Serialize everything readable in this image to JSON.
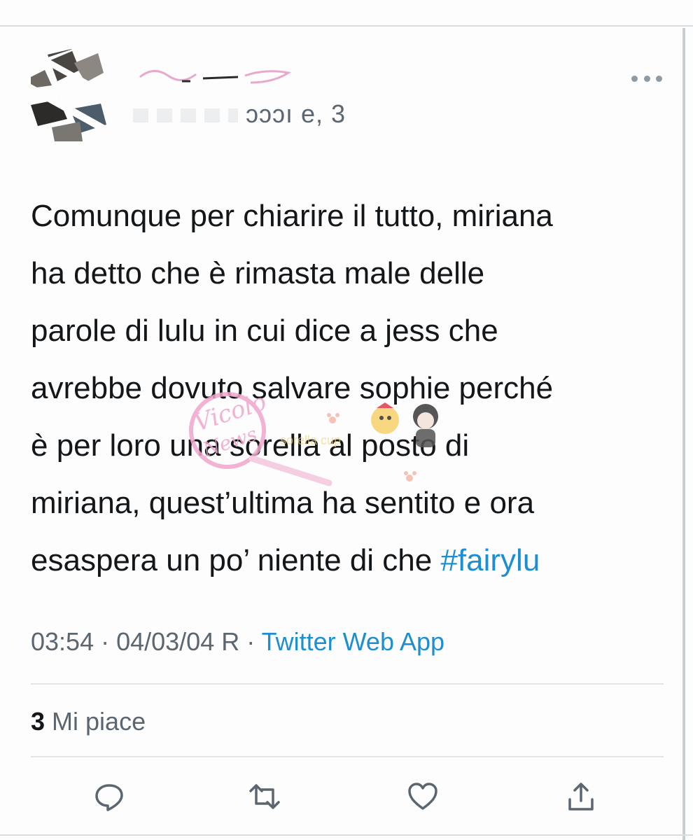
{
  "tweet": {
    "handle_visible": "ɔɔɔı e, 3",
    "text_lines": [
      "Comunque per chiarire il tutto, miriana",
      "ha detto che è rimasta male delle",
      "parole di lulu in cui dice a jess che",
      "avrebbe dovuto salvare sophie perché",
      "è per loro una sorella al posto di",
      "miriana, quest’ultima ha sentito e ora",
      "esaspera un po’ niente di che "
    ],
    "hashtag": "#fairylu",
    "time": "03:54",
    "separator": " · ",
    "date": "04/03/04 R",
    "source": "Twitter Web App",
    "likes_count": "3",
    "likes_label": " Mi piace"
  },
  "colors": {
    "link": "#1d8fd0",
    "secondary_text": "#5b6670",
    "primary_text": "#14171a",
    "divider": "#e3e6e9"
  },
  "icons": {
    "more": "more-horizontal-icon",
    "reply": "reply-icon",
    "retweet": "retweet-icon",
    "like": "heart-icon",
    "share": "share-icon"
  },
  "watermark": {
    "text": "Vicolo News"
  }
}
